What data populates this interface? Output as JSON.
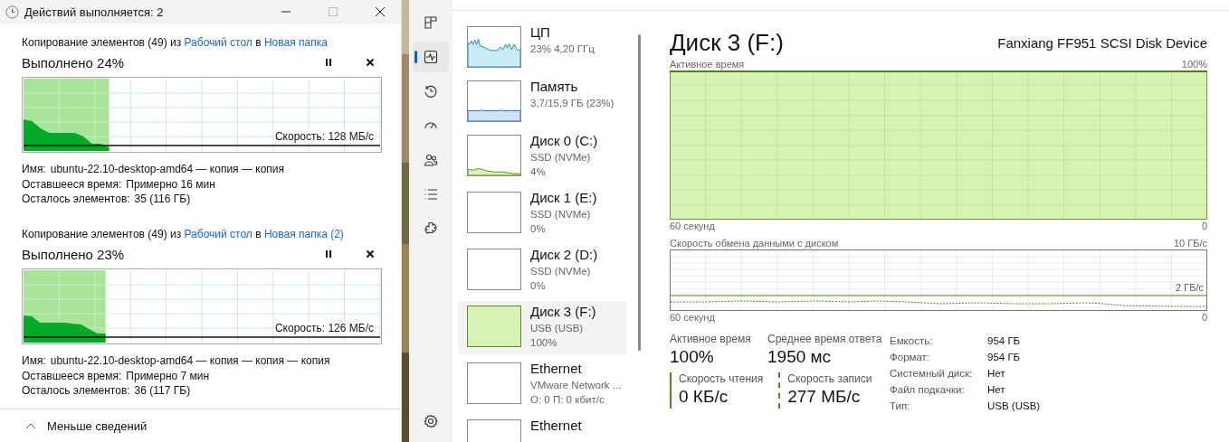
{
  "copy_dialog": {
    "title": "Действий выполняется: 2",
    "operations": [
      {
        "prefix": "Копирование элементов (49) из",
        "source": "Рабочий стол",
        "joiner": "в",
        "destination": "Новая папка",
        "progress_text": "Выполнено 24%",
        "level": 0.24,
        "speed": "Скорость: 128 МБ/с",
        "details": [
          {
            "label": "Имя:",
            "value": "ubuntu-22.10-desktop-amd64 — копия — копия"
          },
          {
            "label": "Оставшееся время:",
            "value": "Примерно 16 мин"
          },
          {
            "label": "Осталось элементов:",
            "value": "35 (116 ГБ)"
          }
        ]
      },
      {
        "prefix": "Копирование элементов (49) из",
        "source": "Рабочий стол",
        "joiner": "в",
        "destination": "Новая папка (2)",
        "progress_text": "Выполнено 23%",
        "level": 0.23,
        "speed": "Скорость: 126 МБ/с",
        "details": [
          {
            "label": "Имя:",
            "value": "ubuntu-22.10-desktop-amd64 — копия — копия — копия"
          },
          {
            "label": "Оставшееся время:",
            "value": "Примерно 7 мин"
          },
          {
            "label": "Осталось элементов:",
            "value": "36 (117 ГБ)"
          }
        ]
      }
    ],
    "toggle": "Меньше сведений"
  },
  "task_manager": {
    "nav": [
      {
        "kind": "processes",
        "selected": false
      },
      {
        "kind": "performance",
        "selected": true
      },
      {
        "kind": "history",
        "selected": false
      },
      {
        "kind": "startup",
        "selected": false
      },
      {
        "kind": "users",
        "selected": false
      },
      {
        "kind": "details",
        "selected": false
      },
      {
        "kind": "services",
        "selected": false
      },
      {
        "kind": "settings",
        "selected": false
      }
    ],
    "devices": [
      {
        "name": "ЦП",
        "lines": [
          "23% 4,20 ГГц"
        ],
        "kind": "cpu",
        "selected": false
      },
      {
        "name": "Память",
        "lines": [
          "3,7/15,9 ГБ (23%)"
        ],
        "kind": "memory",
        "selected": false
      },
      {
        "name": "Диск 0 (C:)",
        "lines": [
          "SSD (NVMe)",
          "4%"
        ],
        "kind": "low",
        "selected": false
      },
      {
        "name": "Диск 1 (E:)",
        "lines": [
          "SSD (NVMe)",
          "0%"
        ],
        "kind": "idle",
        "selected": false
      },
      {
        "name": "Диск 2 (D:)",
        "lines": [
          "SSD (NVMe)",
          "0%"
        ],
        "kind": "idle",
        "selected": false
      },
      {
        "name": "Диск 3 (F:)",
        "lines": [
          "USB (USB)",
          "100%"
        ],
        "kind": "full",
        "selected": true
      },
      {
        "name": "Ethernet",
        "lines": [
          "VMware Network ...",
          "О: 0 П: 0 кбит/с"
        ],
        "kind": "idle",
        "selected": false
      },
      {
        "name": "Ethernet",
        "kind": "idle",
        "selected": false
      }
    ],
    "detail": {
      "title": "Диск 3 (F:)",
      "device": "Fanxiang FF951 SCSI Disk Device",
      "active_chart": {
        "label": "Активное время",
        "max": "100%",
        "span": "60 секунд",
        "min": "0"
      },
      "rate_chart": {
        "label": "Скорость обмена данными с диском",
        "max": "10 ГБ/с",
        "mark": "2 ГБ/с",
        "span": "60 секунд",
        "min": "0"
      },
      "stats": [
        {
          "label": "Активное время",
          "value": "100%"
        },
        {
          "label": "Среднее время ответа",
          "value": "1950 мс"
        }
      ],
      "rates": [
        {
          "label": "Скорость чтения",
          "value": "0 КБ/с",
          "kind": "solid"
        },
        {
          "label": "Скорость записи",
          "value": "277 МБ/с",
          "kind": "dashed"
        }
      ],
      "properties": [
        {
          "label": "Емкость:",
          "value": "954 ГБ"
        },
        {
          "label": "Формат:",
          "value": "954 ГБ"
        },
        {
          "label": "Системный диск:",
          "value": "Нет"
        },
        {
          "label": "Файл подкачки:",
          "value": "Нет"
        },
        {
          "label": "Тип:",
          "value": "USB (USB)"
        }
      ]
    }
  }
}
